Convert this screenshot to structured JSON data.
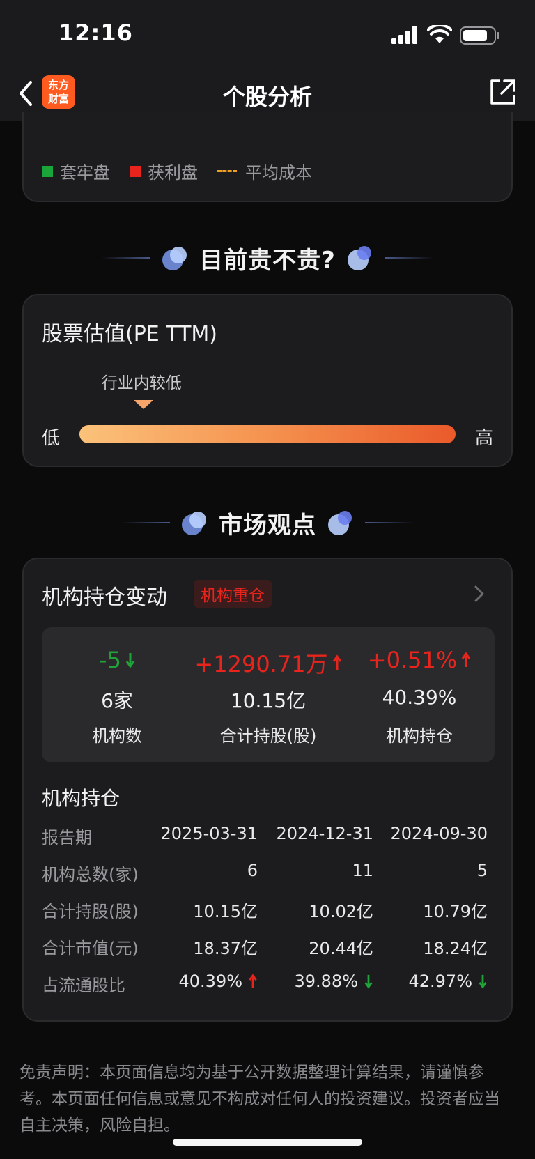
{
  "status_bar": {
    "time": "12:16"
  },
  "nav": {
    "title": "个股分析",
    "logo_line1": "东方",
    "logo_line2": "财富"
  },
  "chip_legend": {
    "items": [
      {
        "label": "套牢盘",
        "color": "#1aa53a"
      },
      {
        "label": "获利盘",
        "color": "#e8241d"
      },
      {
        "label": "平均成本",
        "color": "#f0a020"
      }
    ]
  },
  "section_valuation": {
    "heading": "目前贵不贵?"
  },
  "valuation": {
    "title": "股票估值(PE TTM)",
    "marker_label": "行业内较低",
    "low_label": "低",
    "high_label": "高",
    "position_fraction": 0.17
  },
  "section_market": {
    "heading": "市场观点"
  },
  "institution": {
    "title": "机构持仓变动",
    "tag": "机构重仓",
    "summary": [
      {
        "delta": "-5",
        "direction": "down",
        "value": "6家",
        "label": "机构数"
      },
      {
        "delta": "+1290.71万",
        "direction": "up",
        "value": "10.15亿",
        "label": "合计持股(股)"
      },
      {
        "delta": "+0.51%",
        "direction": "up",
        "value": "40.39%",
        "label": "机构持仓"
      }
    ],
    "table_title": "机构持仓",
    "table": {
      "header": [
        "报告期",
        "2025-03-31",
        "2024-12-31",
        "2024-09-30"
      ],
      "rows": [
        [
          "机构总数(家)",
          "6",
          "11",
          "5"
        ],
        [
          "合计持股(股)",
          "10.15亿",
          "10.02亿",
          "10.79亿"
        ],
        [
          "合计市值(元)",
          "18.37亿",
          "20.44亿",
          "18.24亿"
        ],
        [
          "占流通股比",
          "40.39%",
          "39.88%",
          "42.97%"
        ]
      ],
      "ratio_trend": [
        "up",
        "down",
        "down"
      ]
    }
  },
  "disclaimer": "免责声明：本页面信息均为基于公开数据整理计算结果，请谨慎参考。本页面任何信息或意见不构成对任何人的投资建议。投资者应当自主决策，风险自担。",
  "colors": {
    "up": "#e8241d",
    "down": "#20a43a",
    "accent": "#ff5a1f"
  }
}
